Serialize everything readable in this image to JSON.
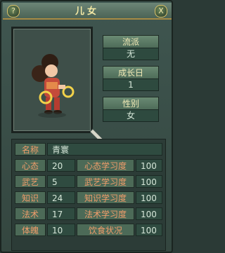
{
  "window": {
    "title": "儿女",
    "help_label": "?",
    "close_label": "X"
  },
  "stats": [
    {
      "label": "流派",
      "value": "无"
    },
    {
      "label": "成长日",
      "value": "1"
    },
    {
      "label": "性别",
      "value": "女"
    }
  ],
  "name_row": {
    "label": "名称",
    "value": "青寰"
  },
  "attributes": [
    {
      "label": "心态",
      "value": "20",
      "study_label": "心态学习度",
      "study_value": "100"
    },
    {
      "label": "武艺",
      "value": "5",
      "study_label": "武艺学习度",
      "study_value": "100"
    },
    {
      "label": "知识",
      "value": "24",
      "study_label": "知识学习度",
      "study_value": "100"
    },
    {
      "label": "法术",
      "value": "17",
      "study_label": "法术学习度",
      "study_value": "100"
    },
    {
      "label": "体魄",
      "value": "10",
      "study_label": "饮食状况",
      "study_value": "100"
    }
  ],
  "colors": {
    "label_text": "#ee9c6a",
    "value_text": "#d5e6d8",
    "title_text": "#f4e9a5"
  },
  "icons": {
    "help": "question-icon",
    "close": "close-icon",
    "cursor": "sword-cursor-icon"
  }
}
